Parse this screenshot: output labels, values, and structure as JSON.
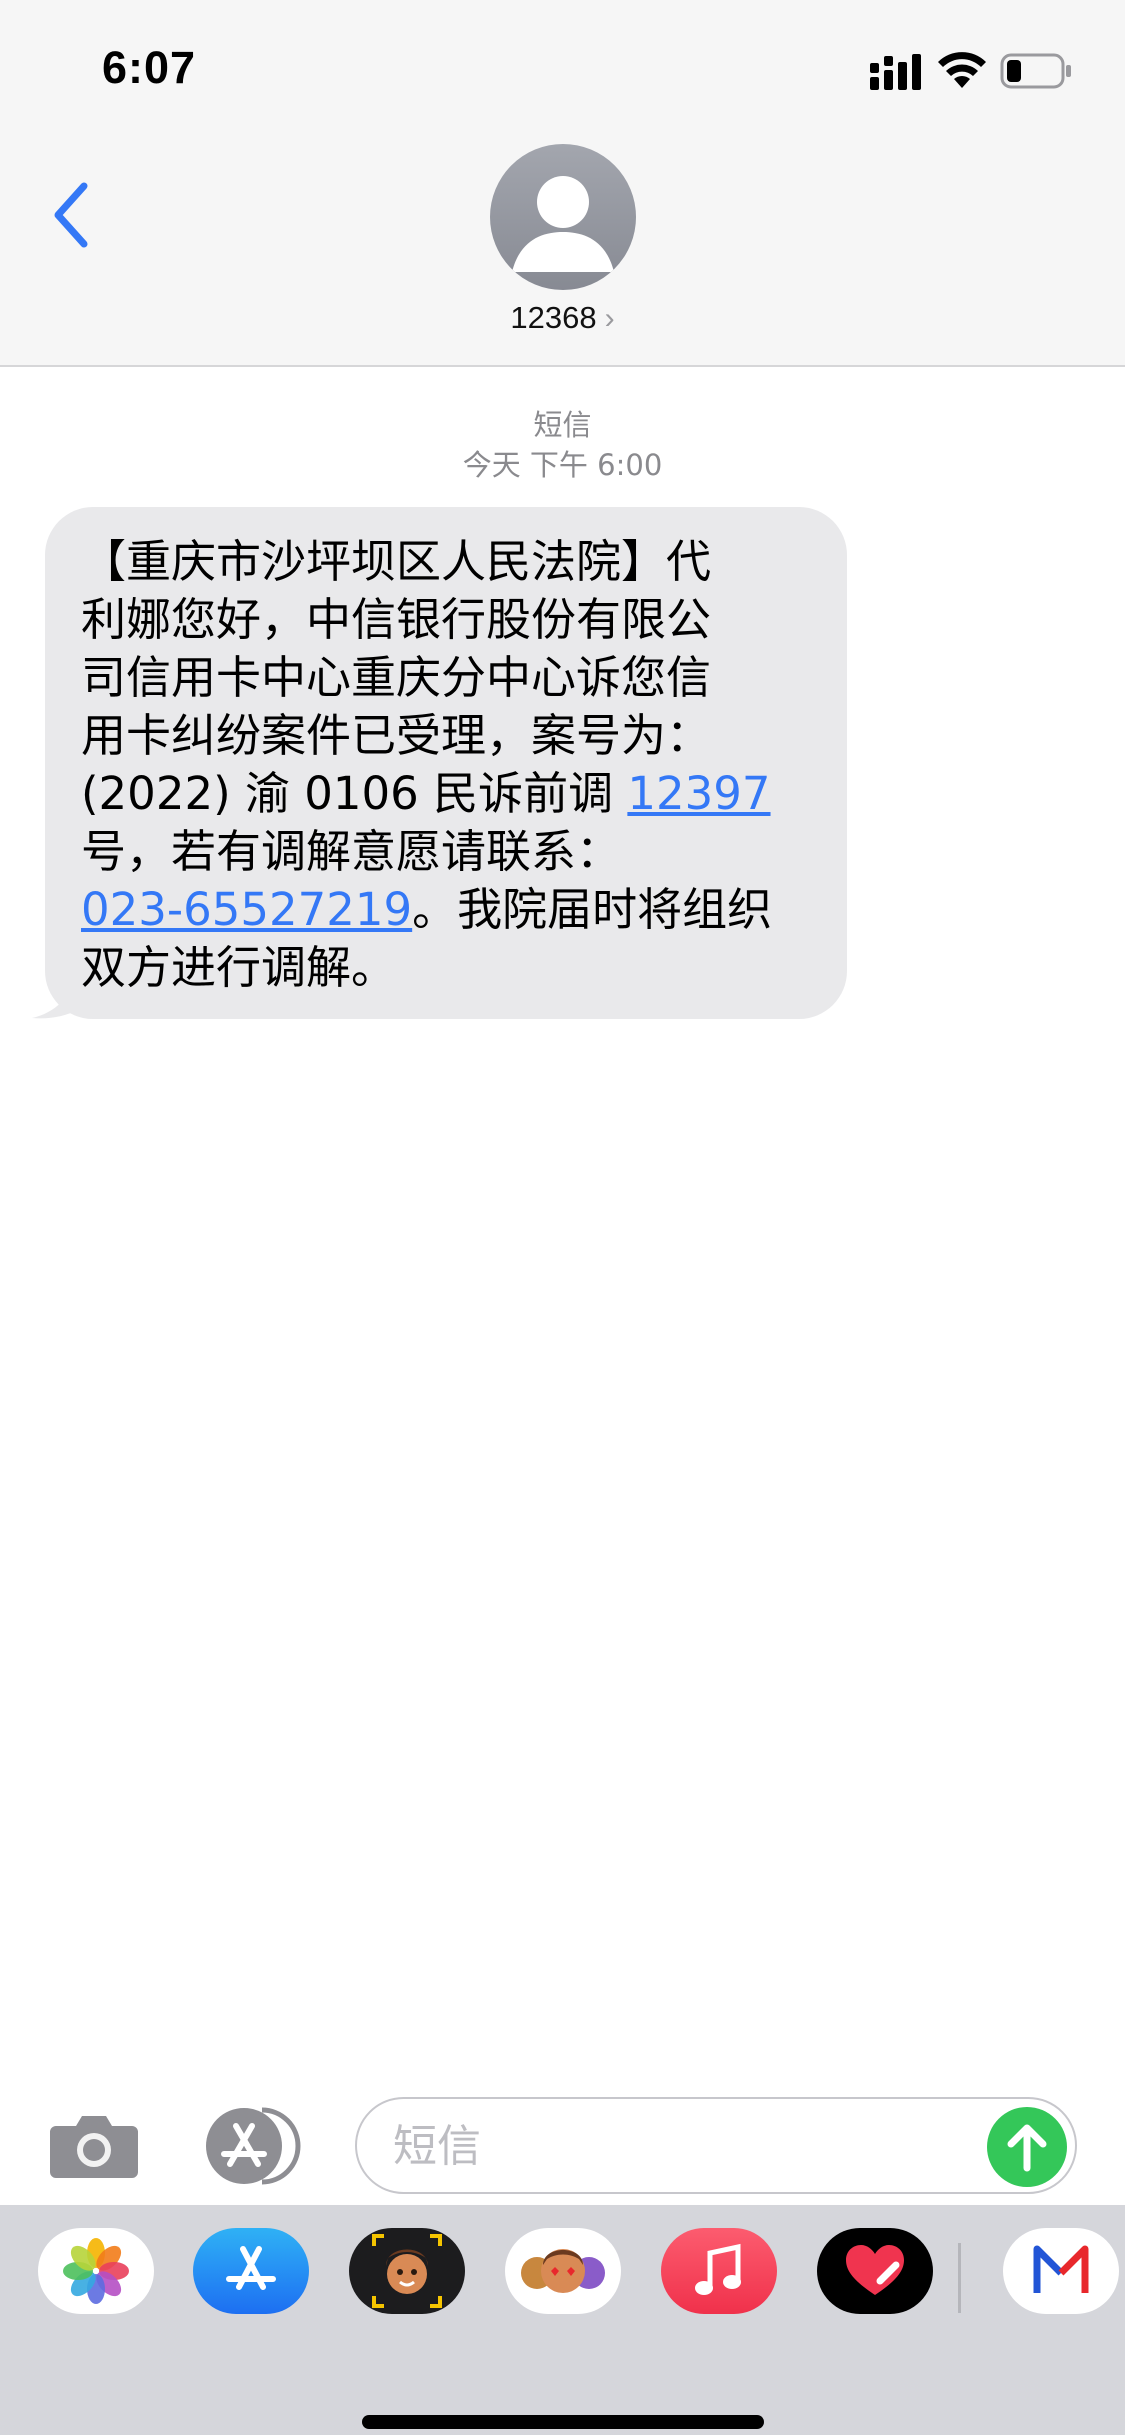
{
  "status_bar": {
    "time": "6:07"
  },
  "header": {
    "contact_name": "12368",
    "chevron": "›"
  },
  "thread": {
    "service_label": "短信",
    "timestamp": "今天 下午 6:00",
    "message": {
      "lines": [
        "【重庆市沙坪坝区人民法院】代",
        "利娜您好，中信银行股份有限公",
        "司信用卡中心重庆分中心诉您信",
        "用卡纠纷案件已受理，案号为：",
        "(2022) 渝 0106 民诉前调 ",
        "号，若有调解意愿请联系：",
        "。我院届时将组织",
        "双方进行调解。"
      ],
      "case_number_link": "12397",
      "phone_link": "023-65527219"
    }
  },
  "input_bar": {
    "placeholder": "短信"
  },
  "dock": {
    "apps": [
      "photos-app-icon",
      "app-store-app-icon",
      "memoji-app-icon",
      "animoji-app-icon",
      "music-app-icon",
      "heart-app-icon",
      "m-app-icon"
    ]
  },
  "colors": {
    "accent": "#3478f6",
    "bubble": "#e9e9eb",
    "send": "#34c759",
    "header_bg": "#f6f6f6",
    "dock_bg": "#d5d6db"
  }
}
